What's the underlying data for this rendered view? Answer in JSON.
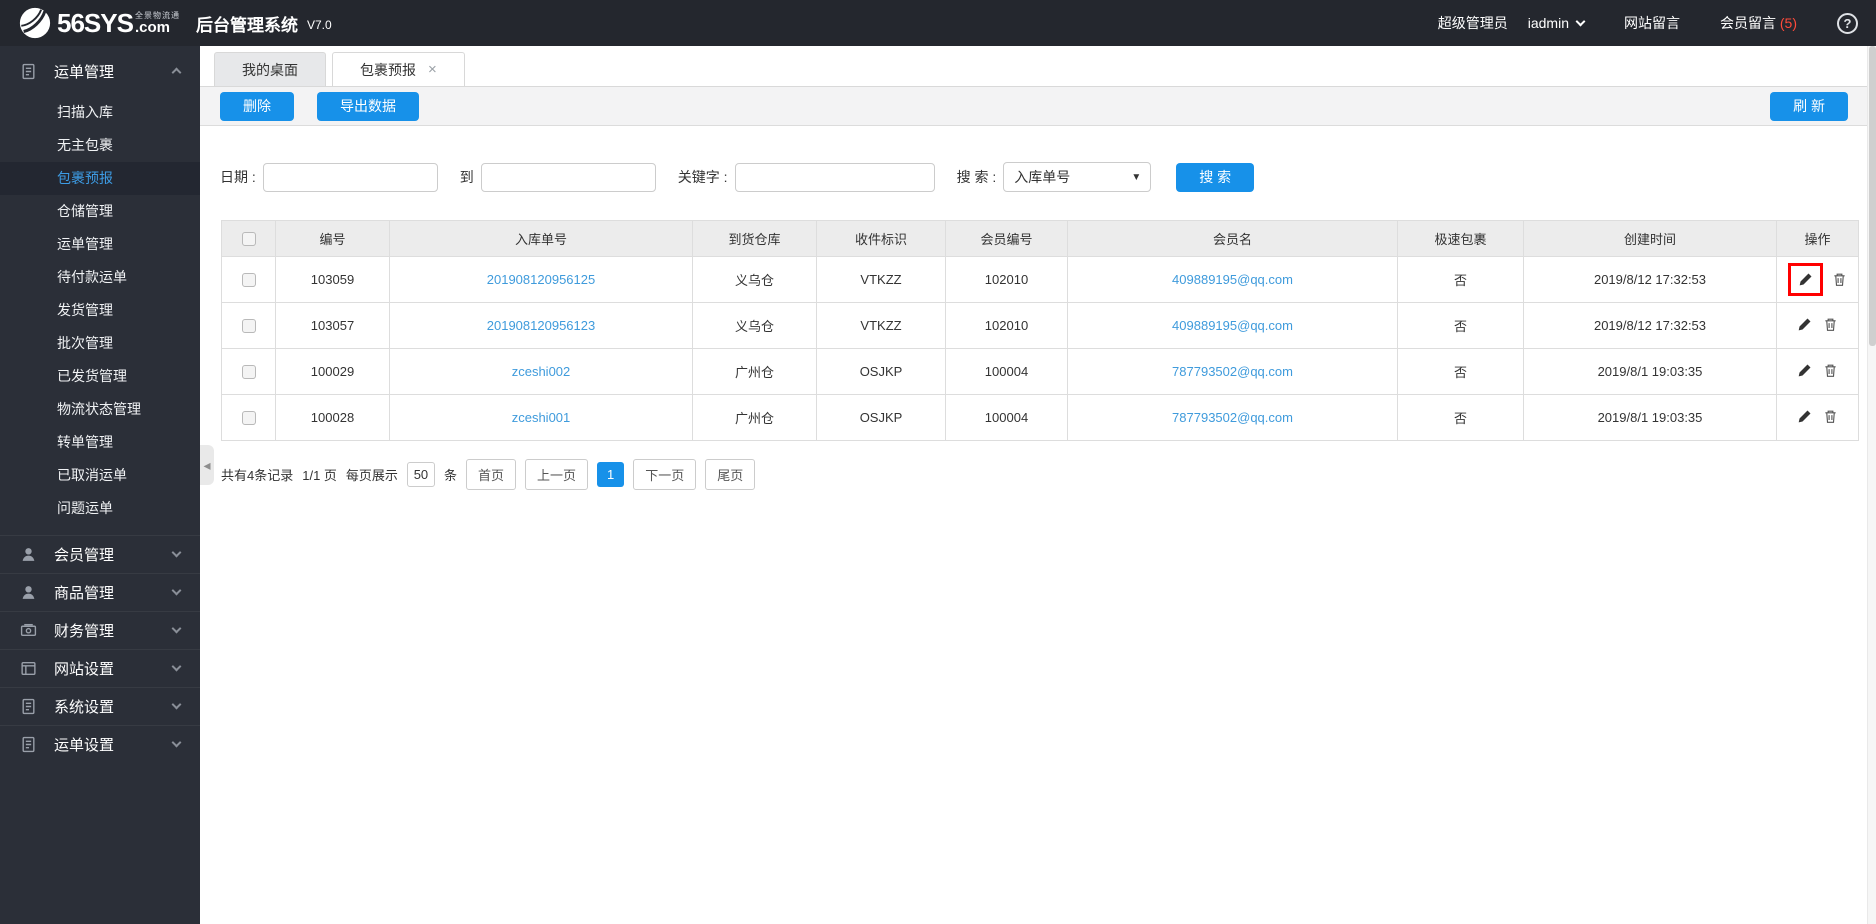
{
  "topbar": {
    "logo_main": "56SYS",
    "logo_sub": "全景物流通",
    "logo_dot": ".com",
    "title": "后台管理系统",
    "version": "V7.0",
    "role": "超级管理员",
    "username": "iadmin",
    "site_messages": "网站留言",
    "member_messages": "会员留言",
    "member_messages_count": "(5)",
    "help_label": "?"
  },
  "sidebar": {
    "groups": [
      {
        "label": "运单管理",
        "icon": "waybill-doc-icon",
        "expanded": true,
        "children": [
          "扫描入库",
          "无主包裹",
          "包裹预报",
          "仓储管理",
          "运单管理",
          "待付款运单",
          "发货管理",
          "批次管理",
          "已发货管理",
          "物流状态管理",
          "转单管理",
          "已取消运单",
          "问题运单"
        ],
        "active_child": "包裹预报"
      },
      {
        "label": "会员管理",
        "icon": "user-icon",
        "expanded": false
      },
      {
        "label": "商品管理",
        "icon": "user-icon",
        "expanded": false
      },
      {
        "label": "财务管理",
        "icon": "money-icon",
        "expanded": false
      },
      {
        "label": "网站设置",
        "icon": "browser-icon",
        "expanded": false
      },
      {
        "label": "系统设置",
        "icon": "doc-icon",
        "expanded": false
      },
      {
        "label": "运单设置",
        "icon": "doc-icon",
        "expanded": false
      }
    ]
  },
  "tabs": [
    {
      "label": "我的桌面",
      "active": false
    },
    {
      "label": "包裹预报",
      "active": true,
      "close": "×"
    }
  ],
  "toolbar": {
    "delete": "删除",
    "export": "导出数据",
    "refresh": "刷 新"
  },
  "search": {
    "date_label": "日期 :",
    "date_from_value": "",
    "to_label": "到",
    "date_to_value": "",
    "keyword_label": "关键字 :",
    "keyword_value": "",
    "search_by_label": "搜 索 :",
    "select_value": "入库单号",
    "button": "搜 索"
  },
  "table": {
    "headers": [
      "编号",
      "入库单号",
      "到货仓库",
      "收件标识",
      "会员编号",
      "会员名",
      "极速包裹",
      "创建时间",
      "操作"
    ],
    "rows": [
      {
        "id": "103059",
        "inbound_no": "201908120956125",
        "warehouse": "义乌仓",
        "recipient_tag": "VTKZZ",
        "member_no": "102010",
        "member_name": "409889195@qq.com",
        "express": "否",
        "created": "2019/8/12 17:32:53"
      },
      {
        "id": "103057",
        "inbound_no": "201908120956123",
        "warehouse": "义乌仓",
        "recipient_tag": "VTKZZ",
        "member_no": "102010",
        "member_name": "409889195@qq.com",
        "express": "否",
        "created": "2019/8/12 17:32:53"
      },
      {
        "id": "100029",
        "inbound_no": "zceshi002",
        "warehouse": "广州仓",
        "recipient_tag": "OSJKP",
        "member_no": "100004",
        "member_name": "787793502@qq.com",
        "express": "否",
        "created": "2019/8/1 19:03:35"
      },
      {
        "id": "100028",
        "inbound_no": "zceshi001",
        "warehouse": "广州仓",
        "recipient_tag": "OSJKP",
        "member_no": "100004",
        "member_name": "787793502@qq.com",
        "express": "否",
        "created": "2019/8/1 19:03:35"
      }
    ]
  },
  "pagination": {
    "total": "共有4条记录",
    "page_info": "1/1 页",
    "per_prefix": "每页展示",
    "per_value": "50",
    "per_suffix": "条",
    "first": "首页",
    "prev": "上一页",
    "current": "1",
    "next": "下一页",
    "last": "尾页"
  },
  "colors": {
    "accent": "#1791e9",
    "link": "#3f9bdc",
    "danger": "#ff4a3a",
    "highlight_box": "#ff0000"
  }
}
